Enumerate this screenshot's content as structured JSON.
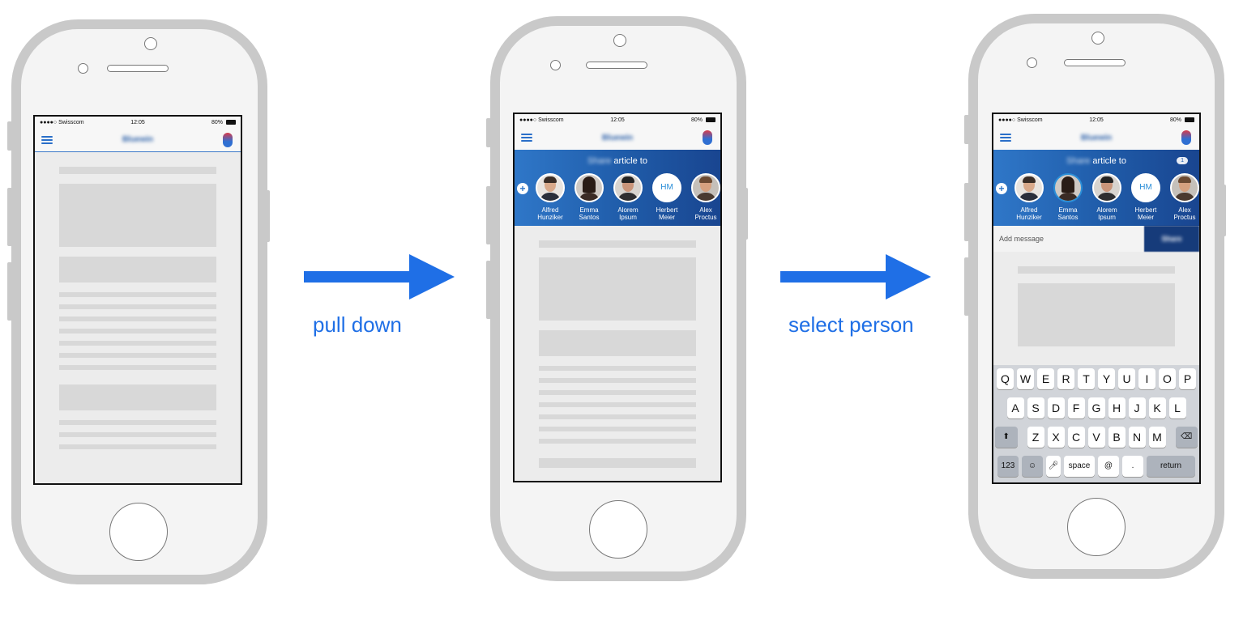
{
  "statusbar": {
    "carrier": "●●●●○ Swisscom",
    "time": "12:05",
    "battery": "80%"
  },
  "nav": {
    "title": "Bluewin"
  },
  "steps": [
    {
      "label": "pull down"
    },
    {
      "label": "select person"
    }
  ],
  "share": {
    "title_blurred": "Share",
    "title": "article to",
    "badge": "1",
    "people": [
      {
        "name": "Alfred\nHunziker",
        "initials": ""
      },
      {
        "name": "Emma\nSantos",
        "initials": ""
      },
      {
        "name": "Alorem\nIpsum",
        "initials": ""
      },
      {
        "name": "Herbert\nMeier",
        "initials": "HM"
      },
      {
        "name": "Alex\nProctus",
        "initials": ""
      }
    ]
  },
  "message": {
    "placeholder": "Add message",
    "send": "Share"
  },
  "keyboard": {
    "row1": [
      "Q",
      "W",
      "E",
      "R",
      "T",
      "Y",
      "U",
      "I",
      "O",
      "P"
    ],
    "row2": [
      "A",
      "S",
      "D",
      "F",
      "G",
      "H",
      "J",
      "K",
      "L"
    ],
    "row3": [
      "Z",
      "X",
      "C",
      "V",
      "B",
      "N",
      "M"
    ],
    "bottom": {
      "num": "123",
      "emoji": "☺",
      "mic": "🎤︎",
      "space": "space",
      "at": "@",
      "dot": ".",
      "return": "return"
    },
    "shift": "⬆",
    "backspace": "⌫"
  },
  "colors": {
    "accent": "#1f6fe6",
    "panel": "#2f77c8",
    "phone_frame": "#c9c9c9"
  }
}
